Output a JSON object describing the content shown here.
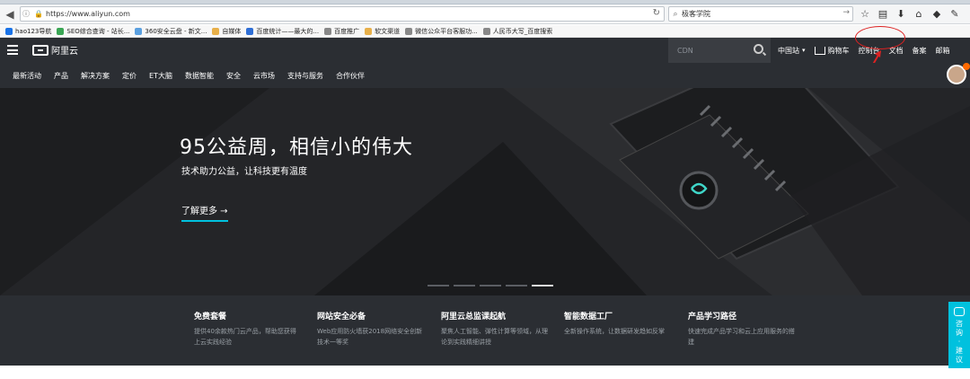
{
  "browser": {
    "url": "https://www.aliyun.com",
    "search_value": "极客学院",
    "bookmarks": [
      {
        "label": "hao123导航",
        "color": "#1a73e8"
      },
      {
        "label": "SEO综合查询 - 站长...",
        "color": "#3aa655"
      },
      {
        "label": "360安全云盘 - 新文...",
        "color": "#5aa0e0"
      },
      {
        "label": "自媒体",
        "color": "#e8b04a"
      },
      {
        "label": "百度统计——最大的...",
        "color": "#2f6fd6"
      },
      {
        "label": "百度推广",
        "color": "#888888"
      },
      {
        "label": "软文渠道",
        "color": "#e8b04a"
      },
      {
        "label": "微信公众平台客服功...",
        "color": "#888888"
      },
      {
        "label": "人民币大写_百度搜索",
        "color": "#888888"
      }
    ]
  },
  "header": {
    "logo_text": "阿里云",
    "search_placeholder": "CDN",
    "region": "中国站",
    "cart": "购物车",
    "console": "控制台",
    "docs": "文档",
    "filing": "备案",
    "mail": "邮箱"
  },
  "nav": {
    "items": [
      "最新活动",
      "产品",
      "解决方案",
      "定价",
      "ET大脑",
      "数据智能",
      "安全",
      "云市场",
      "支持与服务",
      "合作伙伴"
    ]
  },
  "hero": {
    "title": "95公益周，相信小的伟大",
    "subtitle": "技术助力公益，让科技更有温度",
    "cta": "了解更多 →",
    "slide_count": 5,
    "active_slide": 5
  },
  "features": [
    {
      "title": "免费套餐",
      "desc": "提供40余款热门云产品，帮助您获得上云实践经验"
    },
    {
      "title": "网站安全必备",
      "desc": "Web应用防火墙获2018网络安全创新技术一等奖"
    },
    {
      "title": "阿里云总监课起航",
      "desc": "聚焦人工智能、弹性计算等领域，从理论到实践精细讲授"
    },
    {
      "title": "智能数据工厂",
      "desc": "全新操作系统，让数据研发趋如反掌"
    },
    {
      "title": "产品学习路径",
      "desc": "快速完成产品学习和云上应用服务的搭建"
    }
  ],
  "feedback": {
    "label": "咨询·建议"
  }
}
